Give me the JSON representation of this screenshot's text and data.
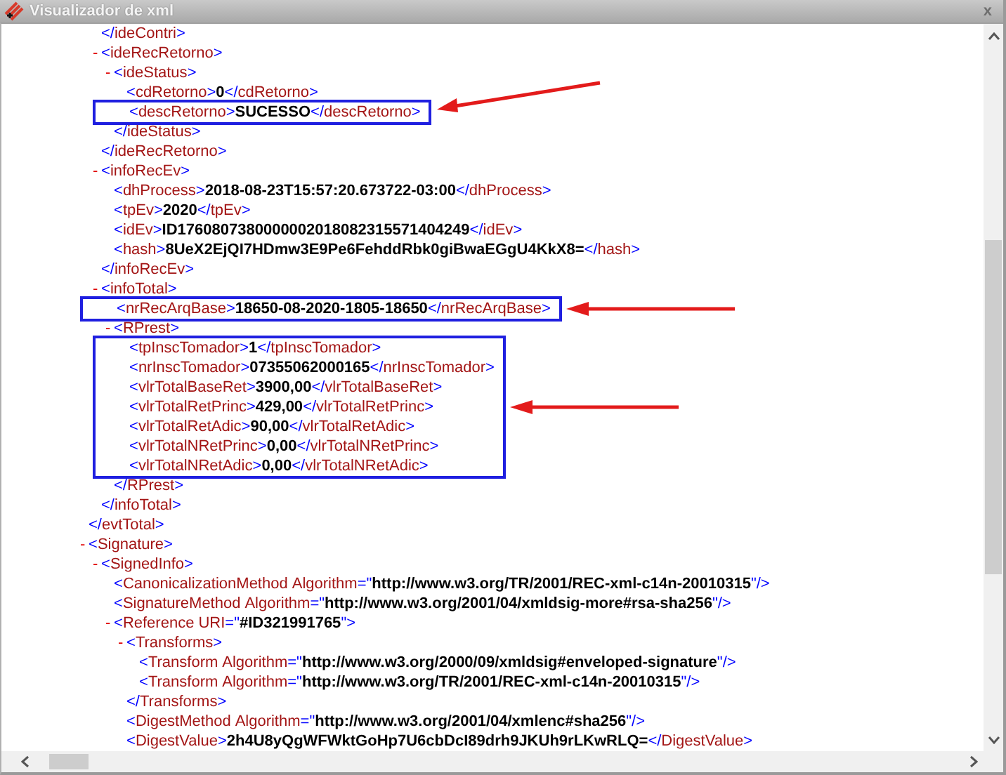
{
  "window": {
    "title": "Visualizador de xml",
    "close_label": "x"
  },
  "xml": [
    {
      "children": [
        {
          "line": [
            {
              "kind": "bracket",
              "text": "</"
            },
            {
              "kind": "tag",
              "text": "ideContri"
            },
            {
              "kind": "bracket",
              "text": ">"
            }
          ]
        },
        {
          "line": [
            {
              "kind": "toggle",
              "text": "-"
            },
            {
              "kind": "bracket",
              "text": "<"
            },
            {
              "kind": "tag",
              "text": "ideRecRetorno"
            },
            {
              "kind": "bracket",
              "text": ">"
            }
          ],
          "expanded": true,
          "children": [
            {
              "line": [
                {
                  "kind": "toggle",
                  "text": "-"
                },
                {
                  "kind": "bracket",
                  "text": "<"
                },
                {
                  "kind": "tag",
                  "text": "ideStatus"
                },
                {
                  "kind": "bracket",
                  "text": ">"
                }
              ],
              "expanded": true,
              "children": [
                {
                  "line": [
                    {
                      "kind": "bracket",
                      "text": "<"
                    },
                    {
                      "kind": "tag",
                      "text": "cdRetorno"
                    },
                    {
                      "kind": "bracket",
                      "text": ">"
                    },
                    {
                      "kind": "value",
                      "text": "0"
                    },
                    {
                      "kind": "bracket",
                      "text": "</"
                    },
                    {
                      "kind": "tag",
                      "text": "cdRetorno"
                    },
                    {
                      "kind": "bracket",
                      "text": ">"
                    }
                  ]
                },
                {
                  "line": [
                    {
                      "kind": "bracket",
                      "text": "<"
                    },
                    {
                      "kind": "tag",
                      "text": "descRetorno"
                    },
                    {
                      "kind": "bracket",
                      "text": ">"
                    },
                    {
                      "kind": "value",
                      "text": "SUCESSO"
                    },
                    {
                      "kind": "bracket",
                      "text": "</"
                    },
                    {
                      "kind": "tag",
                      "text": "descRetorno"
                    },
                    {
                      "kind": "bracket",
                      "text": ">"
                    }
                  ],
                  "highlighted": true,
                  "arrow_rising": true
                }
              ],
              "close": [
                {
                  "kind": "bracket",
                  "text": "</"
                },
                {
                  "kind": "tag",
                  "text": "ideStatus"
                },
                {
                  "kind": "bracket",
                  "text": ">"
                }
              ]
            }
          ],
          "close": [
            {
              "kind": "bracket",
              "text": "</"
            },
            {
              "kind": "tag",
              "text": "ideRecRetorno"
            },
            {
              "kind": "bracket",
              "text": ">"
            }
          ]
        },
        {
          "line": [
            {
              "kind": "toggle",
              "text": "-"
            },
            {
              "kind": "bracket",
              "text": "<"
            },
            {
              "kind": "tag",
              "text": "infoRecEv"
            },
            {
              "kind": "bracket",
              "text": ">"
            }
          ],
          "expanded": true,
          "children": [
            {
              "line": [
                {
                  "kind": "bracket",
                  "text": "<"
                },
                {
                  "kind": "tag",
                  "text": "dhProcess"
                },
                {
                  "kind": "bracket",
                  "text": ">"
                },
                {
                  "kind": "value",
                  "text": "2018-08-23T15:57:20.673722-03:00"
                },
                {
                  "kind": "bracket",
                  "text": "</"
                },
                {
                  "kind": "tag",
                  "text": "dhProcess"
                },
                {
                  "kind": "bracket",
                  "text": ">"
                }
              ]
            },
            {
              "line": [
                {
                  "kind": "bracket",
                  "text": "<"
                },
                {
                  "kind": "tag",
                  "text": "tpEv"
                },
                {
                  "kind": "bracket",
                  "text": ">"
                },
                {
                  "kind": "value",
                  "text": "2020"
                },
                {
                  "kind": "bracket",
                  "text": "</"
                },
                {
                  "kind": "tag",
                  "text": "tpEv"
                },
                {
                  "kind": "bracket",
                  "text": ">"
                }
              ]
            },
            {
              "line": [
                {
                  "kind": "bracket",
                  "text": "<"
                },
                {
                  "kind": "tag",
                  "text": "idEv"
                },
                {
                  "kind": "bracket",
                  "text": ">"
                },
                {
                  "kind": "value",
                  "text": "ID1760807380000002018082315571404249"
                },
                {
                  "kind": "bracket",
                  "text": "</"
                },
                {
                  "kind": "tag",
                  "text": "idEv"
                },
                {
                  "kind": "bracket",
                  "text": ">"
                }
              ]
            },
            {
              "line": [
                {
                  "kind": "bracket",
                  "text": "<"
                },
                {
                  "kind": "tag",
                  "text": "hash"
                },
                {
                  "kind": "bracket",
                  "text": ">"
                },
                {
                  "kind": "value",
                  "text": "8UeX2EjQI7HDmw3E9Pe6FehddRbk0giBwaEGgU4KkX8="
                },
                {
                  "kind": "bracket",
                  "text": "</"
                },
                {
                  "kind": "tag",
                  "text": "hash"
                },
                {
                  "kind": "bracket",
                  "text": ">"
                }
              ]
            }
          ],
          "close": [
            {
              "kind": "bracket",
              "text": "</"
            },
            {
              "kind": "tag",
              "text": "infoRecEv"
            },
            {
              "kind": "bracket",
              "text": ">"
            }
          ]
        },
        {
          "line": [
            {
              "kind": "toggle",
              "text": "-"
            },
            {
              "kind": "bracket",
              "text": "<"
            },
            {
              "kind": "tag",
              "text": "infoTotal"
            },
            {
              "kind": "bracket",
              "text": ">"
            }
          ],
          "expanded": true,
          "children": [
            {
              "line": [
                {
                  "kind": "bracket",
                  "text": "<"
                },
                {
                  "kind": "tag",
                  "text": "nrRecArqBase"
                },
                {
                  "kind": "bracket",
                  "text": ">"
                },
                {
                  "kind": "value",
                  "text": "18650-08-2020-1805-18650"
                },
                {
                  "kind": "bracket",
                  "text": "</"
                },
                {
                  "kind": "tag",
                  "text": "nrRecArqBase"
                },
                {
                  "kind": "bracket",
                  "text": ">"
                }
              ],
              "highlighted": true,
              "arrow_rising": false
            },
            {
              "line": [
                {
                  "kind": "toggle",
                  "text": "-"
                },
                {
                  "kind": "bracket",
                  "text": "<"
                },
                {
                  "kind": "tag",
                  "text": "RPrest"
                },
                {
                  "kind": "bracket",
                  "text": ">"
                }
              ],
              "expanded": true,
              "children": [
                {
                  "line": [
                    {
                      "kind": "bracket",
                      "text": "<"
                    },
                    {
                      "kind": "tag",
                      "text": "tpInscTomador"
                    },
                    {
                      "kind": "bracket",
                      "text": ">"
                    },
                    {
                      "kind": "value",
                      "text": "1"
                    },
                    {
                      "kind": "bracket",
                      "text": "</"
                    },
                    {
                      "kind": "tag",
                      "text": "tpInscTomador"
                    },
                    {
                      "kind": "bracket",
                      "text": ">"
                    }
                  ],
                  "highlighted": true
                },
                {
                  "line": [
                    {
                      "kind": "bracket",
                      "text": "<"
                    },
                    {
                      "kind": "tag",
                      "text": "nrInscTomador"
                    },
                    {
                      "kind": "bracket",
                      "text": ">"
                    },
                    {
                      "kind": "value",
                      "text": "07355062000165"
                    },
                    {
                      "kind": "bracket",
                      "text": "</"
                    },
                    {
                      "kind": "tag",
                      "text": "nrInscTomador"
                    },
                    {
                      "kind": "bracket",
                      "text": ">"
                    }
                  ],
                  "highlighted": true
                },
                {
                  "line": [
                    {
                      "kind": "bracket",
                      "text": "<"
                    },
                    {
                      "kind": "tag",
                      "text": "vlrTotalBaseRet"
                    },
                    {
                      "kind": "bracket",
                      "text": ">"
                    },
                    {
                      "kind": "value",
                      "text": "3900,00"
                    },
                    {
                      "kind": "bracket",
                      "text": "</"
                    },
                    {
                      "kind": "tag",
                      "text": "vlrTotalBaseRet"
                    },
                    {
                      "kind": "bracket",
                      "text": ">"
                    }
                  ],
                  "highlighted": true
                },
                {
                  "line": [
                    {
                      "kind": "bracket",
                      "text": "<"
                    },
                    {
                      "kind": "tag",
                      "text": "vlrTotalRetPrinc"
                    },
                    {
                      "kind": "bracket",
                      "text": ">"
                    },
                    {
                      "kind": "value",
                      "text": "429,00"
                    },
                    {
                      "kind": "bracket",
                      "text": "</"
                    },
                    {
                      "kind": "tag",
                      "text": "vlrTotalRetPrinc"
                    },
                    {
                      "kind": "bracket",
                      "text": ">"
                    }
                  ],
                  "highlighted": true,
                  "arrow_rising": false
                },
                {
                  "line": [
                    {
                      "kind": "bracket",
                      "text": "<"
                    },
                    {
                      "kind": "tag",
                      "text": "vlrTotalRetAdic"
                    },
                    {
                      "kind": "bracket",
                      "text": ">"
                    },
                    {
                      "kind": "value",
                      "text": "90,00"
                    },
                    {
                      "kind": "bracket",
                      "text": "</"
                    },
                    {
                      "kind": "tag",
                      "text": "vlrTotalRetAdic"
                    },
                    {
                      "kind": "bracket",
                      "text": ">"
                    }
                  ],
                  "highlighted": true
                },
                {
                  "line": [
                    {
                      "kind": "bracket",
                      "text": "<"
                    },
                    {
                      "kind": "tag",
                      "text": "vlrTotalNRetPrinc"
                    },
                    {
                      "kind": "bracket",
                      "text": ">"
                    },
                    {
                      "kind": "value",
                      "text": "0,00"
                    },
                    {
                      "kind": "bracket",
                      "text": "</"
                    },
                    {
                      "kind": "tag",
                      "text": "vlrTotalNRetPrinc"
                    },
                    {
                      "kind": "bracket",
                      "text": ">"
                    }
                  ],
                  "highlighted": true
                },
                {
                  "line": [
                    {
                      "kind": "bracket",
                      "text": "<"
                    },
                    {
                      "kind": "tag",
                      "text": "vlrTotalNRetAdic"
                    },
                    {
                      "kind": "bracket",
                      "text": ">"
                    },
                    {
                      "kind": "value",
                      "text": "0,00"
                    },
                    {
                      "kind": "bracket",
                      "text": "</"
                    },
                    {
                      "kind": "tag",
                      "text": "vlrTotalNRetAdic"
                    },
                    {
                      "kind": "bracket",
                      "text": ">"
                    }
                  ],
                  "highlighted": true
                }
              ],
              "close": [
                {
                  "kind": "bracket",
                  "text": "</"
                },
                {
                  "kind": "tag",
                  "text": "RPrest"
                },
                {
                  "kind": "bracket",
                  "text": ">"
                }
              ]
            }
          ],
          "close": [
            {
              "kind": "bracket",
              "text": "</"
            },
            {
              "kind": "tag",
              "text": "infoTotal"
            },
            {
              "kind": "bracket",
              "text": ">"
            }
          ]
        }
      ],
      "close": [
        {
          "kind": "bracket",
          "text": "</"
        },
        {
          "kind": "tag",
          "text": "evtTotal"
        },
        {
          "kind": "bracket",
          "text": ">"
        }
      ]
    },
    {
      "line": [
        {
          "kind": "toggle",
          "text": "-"
        },
        {
          "kind": "bracket",
          "text": "<"
        },
        {
          "kind": "tag",
          "text": "Signature"
        },
        {
          "kind": "bracket",
          "text": ">"
        }
      ],
      "expanded": true,
      "children": [
        {
          "line": [
            {
              "kind": "toggle",
              "text": "-"
            },
            {
              "kind": "bracket",
              "text": "<"
            },
            {
              "kind": "tag",
              "text": "SignedInfo"
            },
            {
              "kind": "bracket",
              "text": ">"
            }
          ],
          "expanded": true,
          "children": [
            {
              "line": [
                {
                  "kind": "bracket",
                  "text": "<"
                },
                {
                  "kind": "tag",
                  "text": "CanonicalizationMethod"
                },
                {
                  "kind": "attr",
                  "text": "Algorithm"
                },
                {
                  "kind": "bracket",
                  "text": "=\""
                },
                {
                  "kind": "value",
                  "text": "http://www.w3.org/TR/2001/REC-xml-c14n-20010315"
                },
                {
                  "kind": "bracket",
                  "text": "\"/>"
                }
              ]
            },
            {
              "line": [
                {
                  "kind": "bracket",
                  "text": "<"
                },
                {
                  "kind": "tag",
                  "text": "SignatureMethod"
                },
                {
                  "kind": "attr",
                  "text": "Algorithm"
                },
                {
                  "kind": "bracket",
                  "text": "=\""
                },
                {
                  "kind": "value",
                  "text": "http://www.w3.org/2001/04/xmldsig-more#rsa-sha256"
                },
                {
                  "kind": "bracket",
                  "text": "\"/>"
                }
              ]
            },
            {
              "line": [
                {
                  "kind": "toggle",
                  "text": "-"
                },
                {
                  "kind": "bracket",
                  "text": "<"
                },
                {
                  "kind": "tag",
                  "text": "Reference"
                },
                {
                  "kind": "attr",
                  "text": "URI"
                },
                {
                  "kind": "bracket",
                  "text": "=\""
                },
                {
                  "kind": "value",
                  "text": "#ID321991765"
                },
                {
                  "kind": "bracket",
                  "text": "\">"
                }
              ],
              "expanded": true,
              "children": [
                {
                  "line": [
                    {
                      "kind": "toggle",
                      "text": "-"
                    },
                    {
                      "kind": "bracket",
                      "text": "<"
                    },
                    {
                      "kind": "tag",
                      "text": "Transforms"
                    },
                    {
                      "kind": "bracket",
                      "text": ">"
                    }
                  ],
                  "expanded": true,
                  "children": [
                    {
                      "line": [
                        {
                          "kind": "bracket",
                          "text": "<"
                        },
                        {
                          "kind": "tag",
                          "text": "Transform"
                        },
                        {
                          "kind": "attr",
                          "text": "Algorithm"
                        },
                        {
                          "kind": "bracket",
                          "text": "=\""
                        },
                        {
                          "kind": "value",
                          "text": "http://www.w3.org/2000/09/xmldsig#enveloped-signature"
                        },
                        {
                          "kind": "bracket",
                          "text": "\"/>"
                        }
                      ]
                    },
                    {
                      "line": [
                        {
                          "kind": "bracket",
                          "text": "<"
                        },
                        {
                          "kind": "tag",
                          "text": "Transform"
                        },
                        {
                          "kind": "attr",
                          "text": "Algorithm"
                        },
                        {
                          "kind": "bracket",
                          "text": "=\""
                        },
                        {
                          "kind": "value",
                          "text": "http://www.w3.org/TR/2001/REC-xml-c14n-20010315"
                        },
                        {
                          "kind": "bracket",
                          "text": "\"/>"
                        }
                      ]
                    }
                  ],
                  "close": [
                    {
                      "kind": "bracket",
                      "text": "</"
                    },
                    {
                      "kind": "tag",
                      "text": "Transforms"
                    },
                    {
                      "kind": "bracket",
                      "text": ">"
                    }
                  ]
                },
                {
                  "line": [
                    {
                      "kind": "bracket",
                      "text": "<"
                    },
                    {
                      "kind": "tag",
                      "text": "DigestMethod"
                    },
                    {
                      "kind": "attr",
                      "text": "Algorithm"
                    },
                    {
                      "kind": "bracket",
                      "text": "=\""
                    },
                    {
                      "kind": "value",
                      "text": "http://www.w3.org/2001/04/xmlenc#sha256"
                    },
                    {
                      "kind": "bracket",
                      "text": "\"/>"
                    }
                  ]
                },
                {
                  "line": [
                    {
                      "kind": "bracket",
                      "text": "<"
                    },
                    {
                      "kind": "tag",
                      "text": "DigestValue"
                    },
                    {
                      "kind": "bracket",
                      "text": ">"
                    },
                    {
                      "kind": "value",
                      "text": "2h4U8yQgWFWktGoHp7U6cbDcI89drh9JKUh9rLKwRLQ="
                    },
                    {
                      "kind": "bracket",
                      "text": "</"
                    },
                    {
                      "kind": "tag",
                      "text": "DigestValue"
                    },
                    {
                      "kind": "bracket",
                      "text": ">"
                    }
                  ]
                }
              ]
            }
          ]
        }
      ]
    }
  ]
}
